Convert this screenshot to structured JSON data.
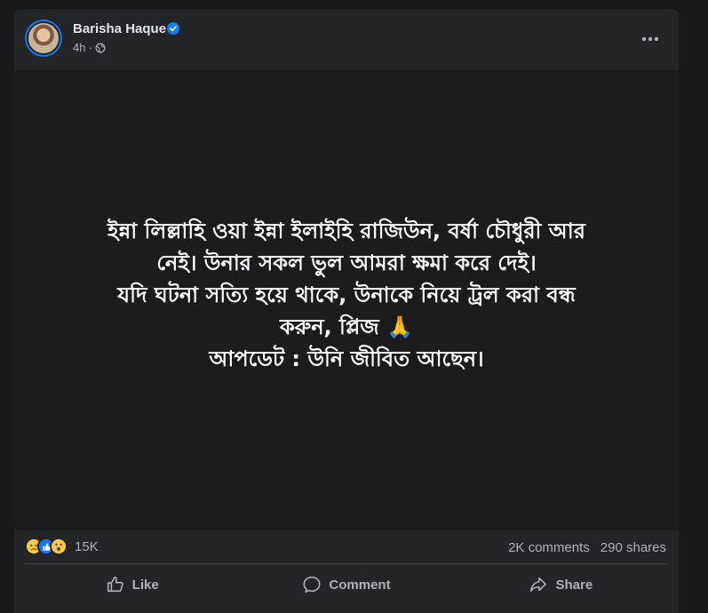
{
  "post": {
    "author": "Barisha Haque",
    "verified": true,
    "time": "4h",
    "separator": "·",
    "audience_icon": "globe-icon",
    "body_text": "ইন্না লিল্লাহি ওয়া ইন্না ইলাইহি রাজিউন, বর্ষা চৌধুরী আর\nনেই। উনার সকল ভুল আমরা ক্ষমা করে দেই।\nযদি ঘটনা সত্যি হয়ে থাকে, উনাকে নিয়ে ট্রল করা বন্ধ\nকরুন, প্লিজ 🙏\nআপডেট : উনি জীবিত আছেন।"
  },
  "stats": {
    "reactions": [
      "sad",
      "like",
      "wow"
    ],
    "reaction_count": "15K",
    "comments": "2K comments",
    "shares": "290 shares"
  },
  "actions": {
    "like": "Like",
    "comment": "Comment",
    "share": "Share"
  },
  "colors": {
    "background": "#18191a",
    "card": "#242526",
    "body": "#1c1c1e",
    "accent": "#1877f2",
    "text_secondary": "#b0b3b8"
  }
}
